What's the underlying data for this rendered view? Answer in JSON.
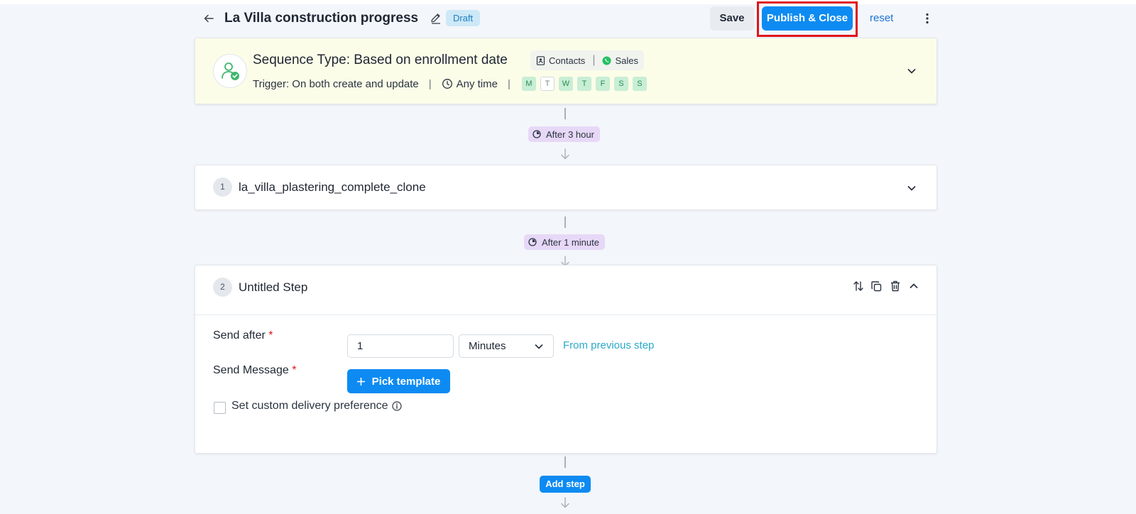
{
  "header": {
    "title": "La Villa construction progress",
    "status_badge": "Draft",
    "save_label": "Save",
    "publish_label": "Publish & Close",
    "reset_label": "reset"
  },
  "sequence": {
    "type_label": "Sequence Type: Based on enrollment date",
    "contacts_chip": "Contacts",
    "sales_chip": "Sales",
    "trigger_label": "Trigger: On both create and update",
    "time_label": "Any time",
    "days": [
      {
        "label": "M",
        "active": true
      },
      {
        "label": "T",
        "active": false
      },
      {
        "label": "W",
        "active": true
      },
      {
        "label": "T",
        "active": true
      },
      {
        "label": "F",
        "active": true
      },
      {
        "label": "S",
        "active": true
      },
      {
        "label": "S",
        "active": true
      }
    ]
  },
  "delays": {
    "first": "After 3 hour",
    "second": "After 1 minute"
  },
  "steps": [
    {
      "number": "1",
      "name": "la_villa_plastering_complete_clone"
    },
    {
      "number": "2",
      "name": "Untitled Step"
    }
  ],
  "step_form": {
    "send_after_label": "Send after",
    "send_after_value": "1",
    "unit_value": "Minutes",
    "from_previous": "From previous step",
    "send_message_label": "Send Message",
    "pick_template_label": "Pick template",
    "required_mark": "*",
    "custom_delivery_label": "Set custom delivery preference",
    "custom_delivery_checked": false
  },
  "add_step_label": "Add step",
  "colors": {
    "primary": "#0d8bf2",
    "highlight_border": "#e0141a",
    "sequence_bg": "#fbfde8",
    "delay_pill": "#e7d8f7",
    "day_active": "#c8eed6"
  }
}
